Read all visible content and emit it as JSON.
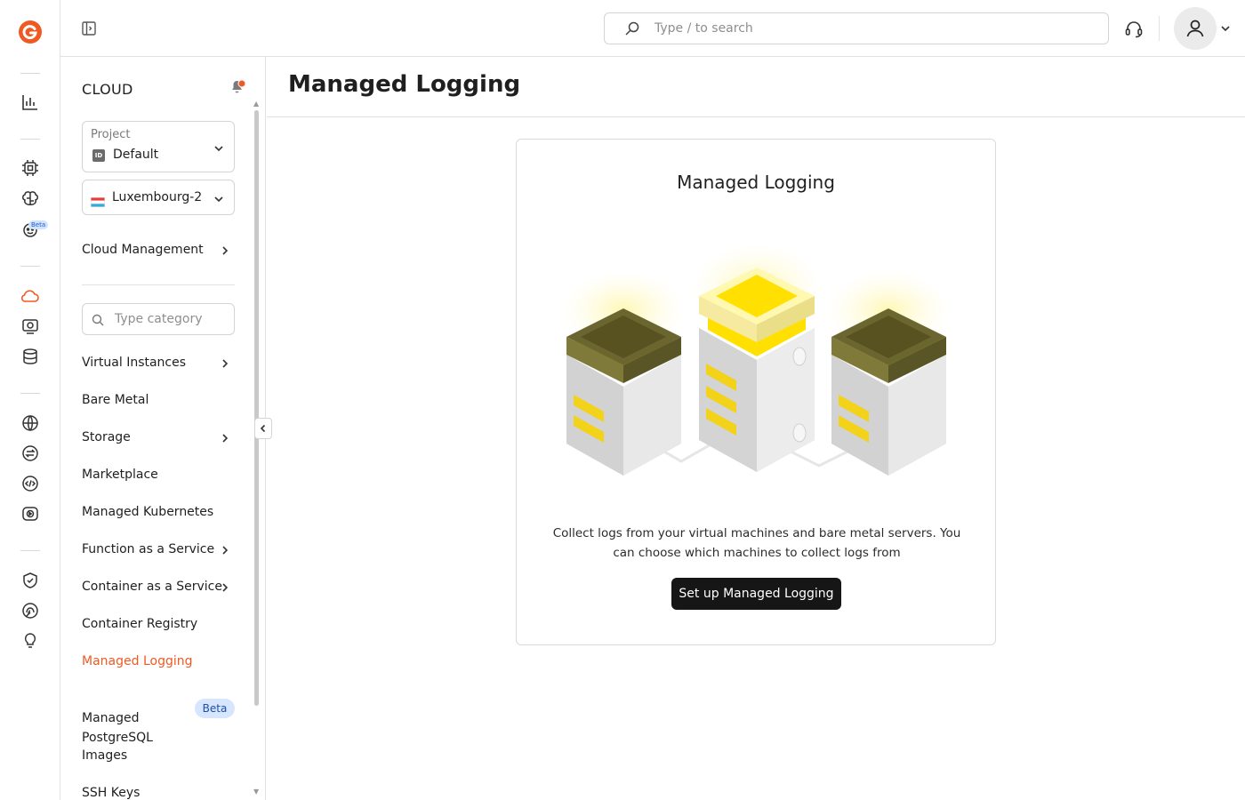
{
  "topbar": {
    "search_placeholder": "Type / to search"
  },
  "rail": {
    "beta_label": "Beta"
  },
  "sidenav": {
    "title": "CLOUD",
    "project": {
      "label": "Project",
      "id_badge": "ID",
      "value": "Default"
    },
    "region": {
      "value": "Luxembourg-2"
    },
    "cloud_management": "Cloud Management",
    "category_search_placeholder": "Type category",
    "items": [
      {
        "label": "Virtual Instances"
      },
      {
        "label": "Bare Metal"
      },
      {
        "label": "Storage"
      },
      {
        "label": "Marketplace"
      },
      {
        "label": "Managed Kubernetes"
      },
      {
        "label": "Function as a Service"
      },
      {
        "label": "Container as a Service"
      },
      {
        "label": "Container Registry"
      },
      {
        "label": "Managed Logging",
        "active": true
      },
      {
        "label": "Managed\nPostgreSQL",
        "badge": "Beta"
      },
      {
        "label": "Images"
      },
      {
        "label": "SSH Keys"
      }
    ]
  },
  "main": {
    "title": "Managed Logging",
    "card": {
      "title": "Managed Logging",
      "description": "Collect logs from your virtual machines and bare metal servers. You can choose which machines to collect logs from",
      "button": "Set up Managed Logging"
    }
  },
  "colors": {
    "accent": "#f05a22",
    "button_bg": "#161616",
    "beta_bg": "#d6e6ff",
    "illustration_yellow": "#ffe000",
    "illustration_olive": "#6b6630"
  },
  "icons": {
    "logo": "gcore-logo-icon",
    "rail": [
      "chart-icon",
      "chip-icon",
      "brain-icon",
      "bot-icon",
      "cloud-icon",
      "monitor-icon",
      "database-icon",
      "globe-icon",
      "transfer-icon",
      "code-icon",
      "video-icon",
      "shield-icon",
      "fingerprint-icon",
      "bulb-icon"
    ]
  }
}
